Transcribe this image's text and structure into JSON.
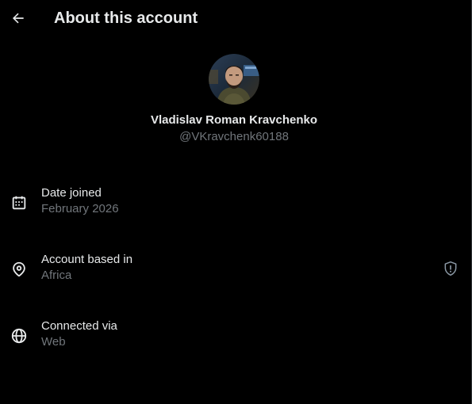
{
  "header": {
    "title": "About this account",
    "back_icon": "arrow-left-icon"
  },
  "profile": {
    "display_name": "Vladislav Roman Kravchenko",
    "handle": "@VKravchenk60188",
    "avatar_icon": "profile-photo"
  },
  "details": {
    "date_joined": {
      "icon": "calendar-icon",
      "label": "Date joined",
      "value": "February 2026"
    },
    "account_based_in": {
      "icon": "location-pin-icon",
      "label": "Account based in",
      "value": "Africa",
      "trailing_icon": "shield-alert-icon"
    },
    "connected_via": {
      "icon": "globe-icon",
      "label": "Connected via",
      "value": "Web"
    }
  },
  "colors": {
    "background": "#000000",
    "primary_text": "#e7e9ea",
    "secondary_text": "#71767b",
    "border": "#2f3336"
  }
}
